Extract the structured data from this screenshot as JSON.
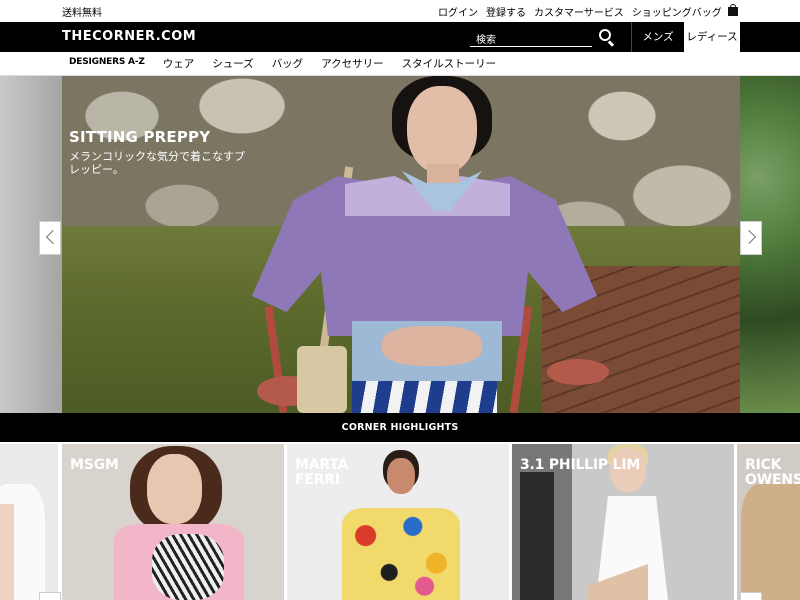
{
  "utility": {
    "free_shipping": "送料無料",
    "login": "ログイン",
    "register": "登録する",
    "customer_service": "カスタマーサービス",
    "shopping_bag": "ショッピングバッグ"
  },
  "header": {
    "logo": "THECORNER.COM",
    "search_placeholder": "検索",
    "tab_men": "メンズ",
    "tab_women": "レディース"
  },
  "nav": {
    "items": [
      "DESIGNERS A-Z",
      "ウェア",
      "シューズ",
      "バッグ",
      "アクセサリー",
      "スタイルストーリー"
    ]
  },
  "hero": {
    "title": "SITTING PREPPY",
    "subtitle": "メランコリックな気分で着こなすプレッピー。"
  },
  "section": {
    "title": "CORNER HIGHLIGHTS"
  },
  "cards": [
    {
      "label": "MSGM"
    },
    {
      "label": "MARTA FERRI"
    },
    {
      "label": "3.1 PHILLIP LIM"
    },
    {
      "label": "RICK OWENS"
    }
  ],
  "colors": {
    "header_bg": "#000000",
    "accent": "#ffffff"
  }
}
